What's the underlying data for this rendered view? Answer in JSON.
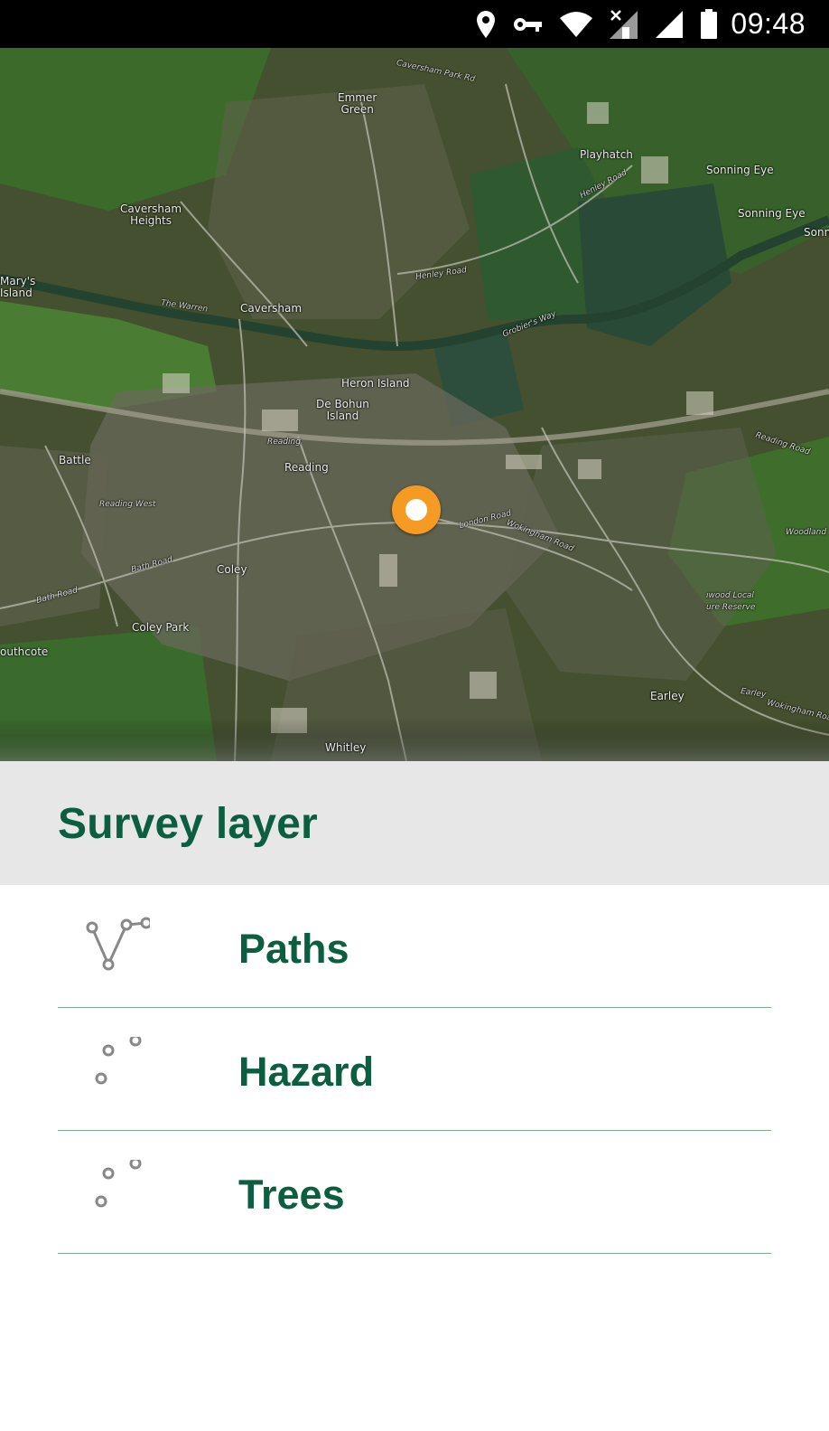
{
  "status_bar": {
    "time": "09:48",
    "icons": [
      "location-pin-icon",
      "vpn-key-icon",
      "wifi-icon",
      "no-data-signal-icon",
      "cell-signal-icon",
      "battery-icon"
    ]
  },
  "map": {
    "type": "satellite",
    "marker_color": "#f59a23",
    "labels": [
      {
        "text": "Emmer\nGreen"
      },
      {
        "text": "Playhatch"
      },
      {
        "text": "Sonning Eye"
      },
      {
        "text": "Sonning Eye"
      },
      {
        "text": "Sonn"
      },
      {
        "text": "Caversham\nHeights"
      },
      {
        "text": "Mary's\nIsland"
      },
      {
        "text": "Caversham"
      },
      {
        "text": "Heron Island"
      },
      {
        "text": "De Bohun\nIsland"
      },
      {
        "text": "Battle"
      },
      {
        "text": "Reading"
      },
      {
        "text": "Coley"
      },
      {
        "text": "Coley Park"
      },
      {
        "text": "outhcote"
      },
      {
        "text": "Earley"
      },
      {
        "text": "Whitley"
      },
      {
        "text": "ıwood Local\nure Reserve"
      }
    ],
    "road_labels": [
      {
        "text": "Caversham Park Rd"
      },
      {
        "text": "Henley Road"
      },
      {
        "text": "Henley Road"
      },
      {
        "text": "Grobier's Way"
      },
      {
        "text": "The Warren"
      },
      {
        "text": "Reading West"
      },
      {
        "text": "Bath Road"
      },
      {
        "text": "Bath Road"
      },
      {
        "text": "London Road"
      },
      {
        "text": "Wokingham Road"
      },
      {
        "text": "Reading Road"
      },
      {
        "text": "Earley"
      },
      {
        "text": "Wokingham Road"
      },
      {
        "text": "Woodland"
      },
      {
        "text": "Reading"
      }
    ]
  },
  "sheet": {
    "title": "Survey layer",
    "accent_color": "#0b5e40",
    "layers": [
      {
        "label": "Paths",
        "icon": "line-path-icon"
      },
      {
        "label": "Hazard",
        "icon": "points-icon"
      },
      {
        "label": "Trees",
        "icon": "points-icon"
      }
    ]
  }
}
